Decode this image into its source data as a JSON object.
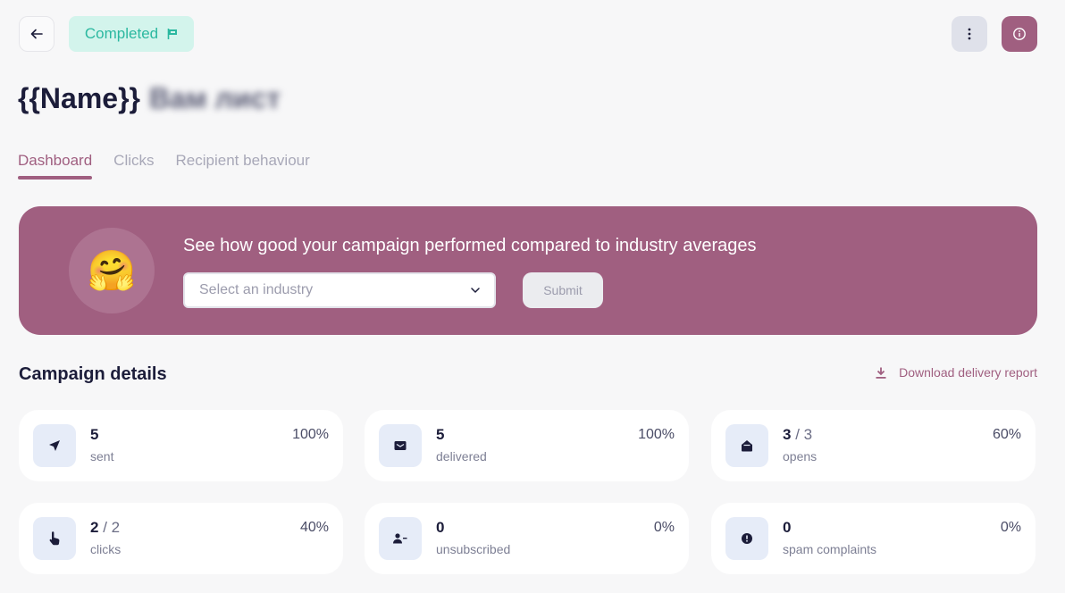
{
  "header": {
    "back_icon": "arrow-left-icon",
    "status": "Completed",
    "status_icon": "flag-icon",
    "more_icon": "vertical-dots-icon",
    "info_icon": "info-circle-icon",
    "title_prefix": "{{Name}}",
    "title_blurred": "Вам лист"
  },
  "tabs": [
    {
      "label": "Dashboard",
      "active": true
    },
    {
      "label": "Clicks",
      "active": false
    },
    {
      "label": "Recipient behaviour",
      "active": false
    }
  ],
  "banner": {
    "emoji": "🤗",
    "title": "See how good your campaign performed compared to industry averages",
    "select_placeholder": "Select an industry",
    "submit_label": "Submit"
  },
  "details": {
    "title": "Campaign details",
    "download_label": "Download delivery report",
    "stats": [
      {
        "icon": "send-icon",
        "value": "5",
        "total": "",
        "label": "sent",
        "percent": "100%"
      },
      {
        "icon": "envelope-icon",
        "value": "5",
        "total": "",
        "label": "delivered",
        "percent": "100%"
      },
      {
        "icon": "envelope-open-icon",
        "value": "3",
        "total": " / 3",
        "label": "opens",
        "percent": "60%"
      },
      {
        "icon": "pointer-hand-icon",
        "value": "2",
        "total": " / 2",
        "label": "clicks",
        "percent": "40%"
      },
      {
        "icon": "user-minus-icon",
        "value": "0",
        "total": "",
        "label": "unsubscribed",
        "percent": "0%"
      },
      {
        "icon": "alert-circle-icon",
        "value": "0",
        "total": "",
        "label": "spam complaints",
        "percent": "0%"
      }
    ]
  },
  "colors": {
    "accent": "#a05f80",
    "status_bg": "#d3f4ec",
    "status_text": "#2bb8a0",
    "icon_bg": "#e6ecf8"
  }
}
